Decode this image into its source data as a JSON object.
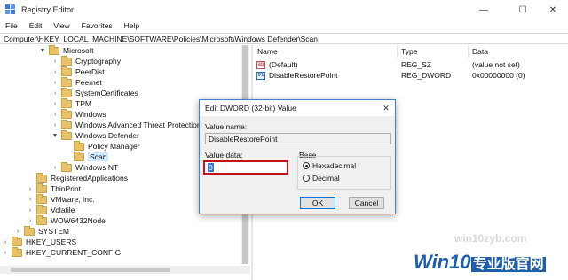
{
  "window": {
    "title": "Registry Editor"
  },
  "menu": [
    "File",
    "Edit",
    "View",
    "Favorites",
    "Help"
  ],
  "address": "Computer\\HKEY_LOCAL_MACHINE\\SOFTWARE\\Policies\\Microsoft\\Windows Defender\\Scan",
  "tree": [
    {
      "label": "Microsoft",
      "arrow": "▼"
    },
    {
      "label": "Cryptography",
      "arrow": "›"
    },
    {
      "label": "PeerDist",
      "arrow": "›"
    },
    {
      "label": "Peernet",
      "arrow": "›"
    },
    {
      "label": "SystemCertificates",
      "arrow": "›"
    },
    {
      "label": "TPM",
      "arrow": "›"
    },
    {
      "label": "Windows",
      "arrow": "›"
    },
    {
      "label": "Windows Advanced Threat Protection",
      "arrow": "›"
    },
    {
      "label": "Windows Defender",
      "arrow": "▼"
    },
    {
      "label": "Policy Manager",
      "arrow": ""
    },
    {
      "label": "Scan",
      "arrow": ""
    },
    {
      "label": "Windows NT",
      "arrow": "›"
    },
    {
      "label": "RegisteredApplications",
      "arrow": ""
    },
    {
      "label": "ThinPrint",
      "arrow": "›"
    },
    {
      "label": "VMware, Inc.",
      "arrow": "›"
    },
    {
      "label": "Volatile",
      "arrow": "›"
    },
    {
      "label": "WOW6432Node",
      "arrow": "›"
    },
    {
      "label": "SYSTEM",
      "arrow": "›"
    },
    {
      "label": "HKEY_USERS",
      "arrow": "›"
    },
    {
      "label": "HKEY_CURRENT_CONFIG",
      "arrow": "›"
    }
  ],
  "values_pane": {
    "headers": {
      "name": "Name",
      "type": "Type",
      "data": "Data"
    },
    "rows": [
      {
        "name": "(Default)",
        "type": "REG_SZ",
        "data": "(value not set)",
        "icon": "string-value-icon",
        "icon_text": "ab"
      },
      {
        "name": "DisableRestorePoint",
        "type": "REG_DWORD",
        "data": "0x00000000 (0)",
        "icon": "binary-value-icon",
        "icon_text": "01"
      }
    ]
  },
  "dialog": {
    "title": "Edit DWORD (32-bit) Value",
    "close": "✕",
    "value_name_label": "Value name:",
    "value_name": "DisableRestorePoint",
    "value_data_label": "Value data:",
    "value_data": "0",
    "base_label": "Base",
    "hex_label": "Hexadecimal",
    "dec_label": "Decimal",
    "ok_label": "OK",
    "cancel_label": "Cancel"
  },
  "watermark": {
    "url": "win10zyb.com",
    "brand": "Win10",
    "brand_cn": "专业版官网"
  }
}
